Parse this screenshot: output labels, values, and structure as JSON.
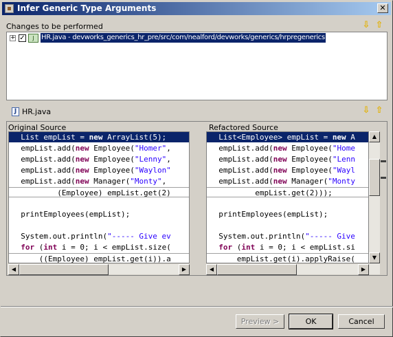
{
  "window": {
    "title": "Infer Generic Type Arguments",
    "close_glyph": "✕"
  },
  "changes": {
    "header": "Changes to be performed",
    "tree_expand_glyph": "+",
    "tree_check_glyph": "✓",
    "tree_item": "HR.java - devworks_generics_hr_pre/src/com/nealford/devworks/generics/hrpregenerics",
    "nav_down_glyph": "⇩",
    "nav_up_glyph": "⇧"
  },
  "file": {
    "name": "HR.java",
    "icon_glyph": "J",
    "nav_down_glyph": "⇩",
    "nav_up_glyph": "⇧"
  },
  "compare": {
    "original_header": "Original Source",
    "refactored_header": "Refactored Source",
    "original_lines": [
      {
        "pre": "  List empList = ",
        "kw": "new",
        "post": " ArrayList(5);",
        "style": "sel"
      },
      {
        "pre": "  empList.add(",
        "kw": "new",
        "post": " Employee(",
        "str": "\"Homer\"",
        "tail": ",",
        "style": ""
      },
      {
        "pre": "  empList.add(",
        "kw": "new",
        "post": " Employee(",
        "str": "\"Lenny\"",
        "tail": ",",
        "style": ""
      },
      {
        "pre": "  empList.add(",
        "kw": "new",
        "post": " Employee(",
        "str": "\"Waylon\"",
        "tail": "",
        "style": ""
      },
      {
        "pre": "  empList.add(",
        "kw": "new",
        "post": " Manager(",
        "str": "\"Monty\"",
        "tail": ",",
        "style": ""
      },
      {
        "pre": "          (Employee) empList.get(2)",
        "kw": "",
        "post": "",
        "style": "box"
      },
      {
        "pre": "",
        "kw": "",
        "post": "",
        "style": ""
      },
      {
        "pre": "  printEmployees(empList);",
        "kw": "",
        "post": "",
        "style": ""
      },
      {
        "pre": "",
        "kw": "",
        "post": "",
        "style": ""
      },
      {
        "pre": "  System.out.println(",
        "kw": "",
        "post": "",
        "str": "\"----- Give ev",
        "style": ""
      },
      {
        "pre": "  ",
        "kw": "for",
        "post": " (",
        "kw2": "int",
        "post2": " i = 0; i < empList.size(",
        "style": ""
      },
      {
        "pre": "      ((Employee) empList.get(i)).a",
        "kw": "",
        "post": "",
        "style": "box"
      }
    ],
    "refactored_lines": [
      {
        "pre": "  List<Employee> empList = ",
        "kw": "new",
        "post": " A",
        "style": "sel"
      },
      {
        "pre": "  empList.add(",
        "kw": "new",
        "post": " Employee(",
        "str": "\"Home",
        "tail": "",
        "style": ""
      },
      {
        "pre": "  empList.add(",
        "kw": "new",
        "post": " Employee(",
        "str": "\"Lenn",
        "tail": "",
        "style": ""
      },
      {
        "pre": "  empList.add(",
        "kw": "new",
        "post": " Employee(",
        "str": "\"Wayl",
        "tail": "",
        "style": ""
      },
      {
        "pre": "  empList.add(",
        "kw": "new",
        "post": " Manager(",
        "str": "\"Monty",
        "tail": "",
        "style": ""
      },
      {
        "pre": "          empList.get(2)));",
        "kw": "",
        "post": "",
        "style": "box"
      },
      {
        "pre": "",
        "kw": "",
        "post": "",
        "style": ""
      },
      {
        "pre": "  printEmployees(empList);",
        "kw": "",
        "post": "",
        "style": ""
      },
      {
        "pre": "",
        "kw": "",
        "post": "",
        "style": ""
      },
      {
        "pre": "  System.out.println(",
        "kw": "",
        "post": "",
        "str": "\"----- Give",
        "style": ""
      },
      {
        "pre": "  ",
        "kw": "for",
        "post": " (",
        "kw2": "int",
        "post2": " i = 0; i < empList.si",
        "style": ""
      },
      {
        "pre": "      empList.get(i).applyRaise(",
        "kw": "",
        "post": "",
        "style": "box"
      }
    ],
    "scroll_left_glyph": "◀",
    "scroll_right_glyph": "▶",
    "scroll_up_glyph": "▲",
    "scroll_down_glyph": "▼"
  },
  "buttons": {
    "preview": "Preview >",
    "ok": "OK",
    "cancel": "Cancel"
  },
  "colors": {
    "selection": "#0a246a",
    "keyword": "#7f0055",
    "string": "#2a00ff",
    "dialog_bg": "#d4d0c8"
  }
}
